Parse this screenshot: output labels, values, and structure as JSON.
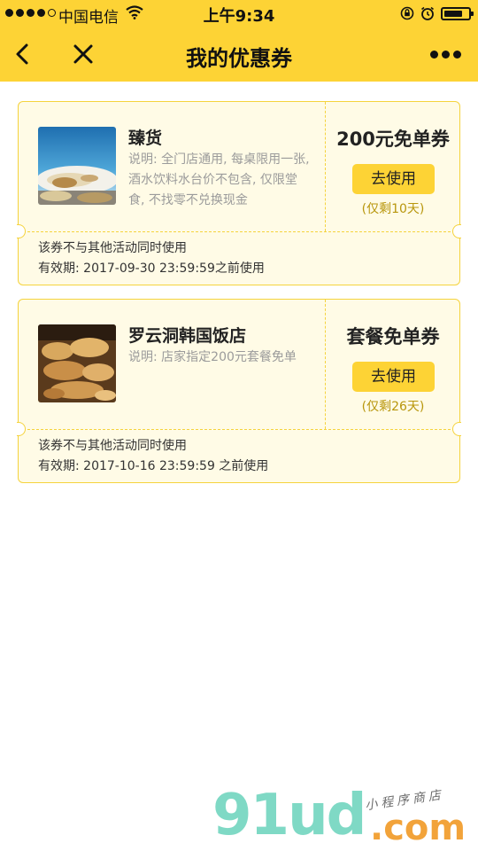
{
  "status_bar": {
    "carrier": "中国电信",
    "time": "上午9:34",
    "battery_level": 0.75
  },
  "nav": {
    "title": "我的优惠券"
  },
  "coupons": [
    {
      "shop": "臻货",
      "desc": "说明: 全门店通用, 每桌限用一张, 酒水饮料水台价不包含, 仅限堂食, 不找零不兑换现金",
      "type": "200元免单券",
      "button": "去使用",
      "remain": "(仅剩10天)",
      "rule": "该券不与其他活动同时使用",
      "validity": "有效期: 2017-09-30 23:59:59之前使用"
    },
    {
      "shop": "罗云洞韩国饭店",
      "desc": "说明: 店家指定200元套餐免单",
      "type": "套餐免单券",
      "button": "去使用",
      "remain": "(仅剩26天)",
      "rule": "该券不与其他活动同时使用",
      "validity": "有效期: 2017-10-16 23:59:59 之前使用"
    }
  ],
  "watermark": {
    "logo": "91ud",
    "domain": ".com",
    "tagline": "小程序商店"
  },
  "colors": {
    "brand_yellow": "#fdd335",
    "coupon_bg": "#fffbe6",
    "coupon_border": "#f5d33d",
    "remain_text": "#b8960c"
  },
  "icons": [
    "signal-dots-icon",
    "wifi-icon",
    "orientation-lock-icon",
    "alarm-icon",
    "battery-icon",
    "back-arrow-icon",
    "close-icon",
    "more-icon"
  ]
}
